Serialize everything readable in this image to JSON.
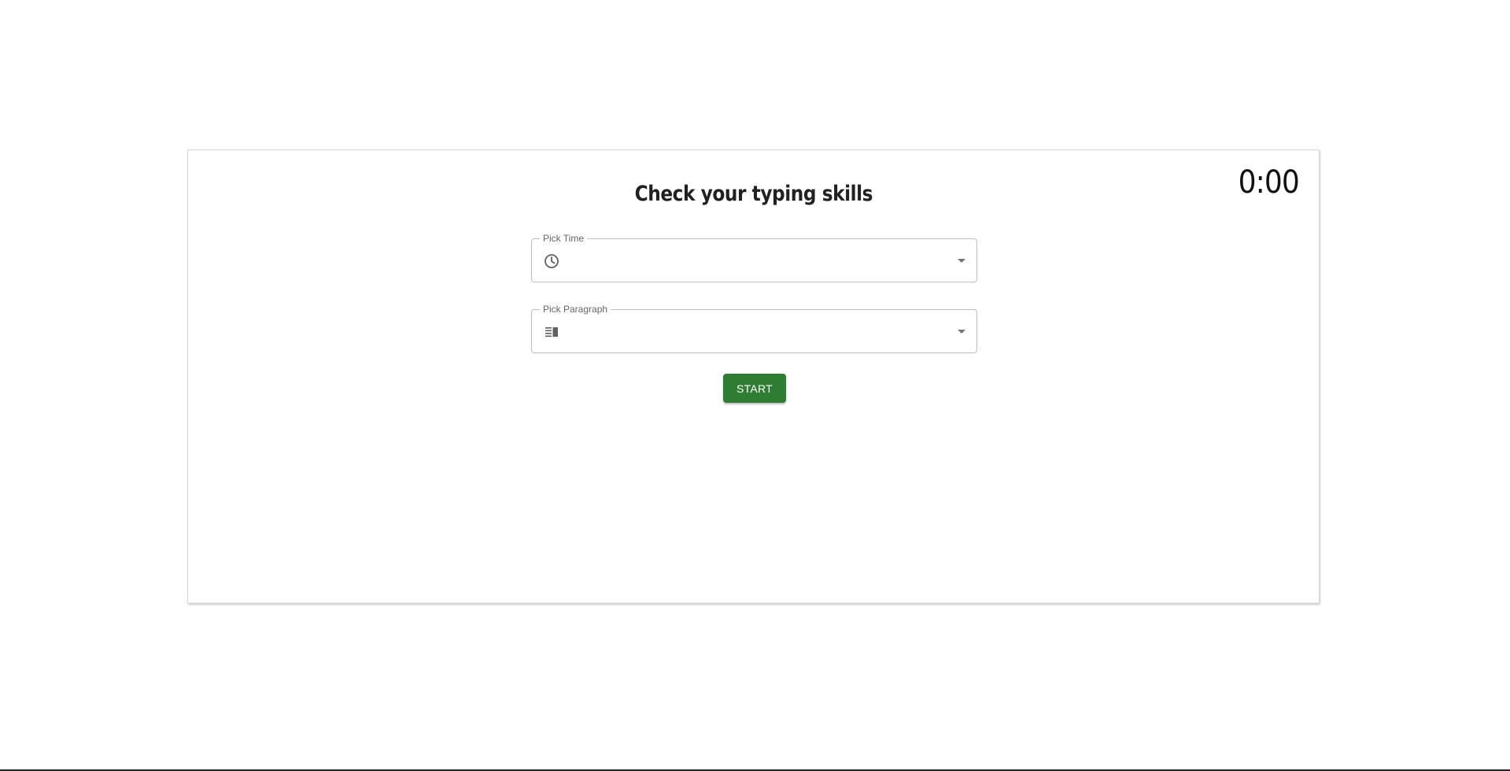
{
  "timer": {
    "value": "0:00"
  },
  "title": "Check your typing skills",
  "fields": {
    "time": {
      "label": "Pick Time",
      "icon": "clock-icon",
      "value": ""
    },
    "paragraph": {
      "label": "Pick Paragraph",
      "icon": "paragraph-icon",
      "value": ""
    }
  },
  "start_button": {
    "label": "START",
    "color": "#2e7d32"
  }
}
